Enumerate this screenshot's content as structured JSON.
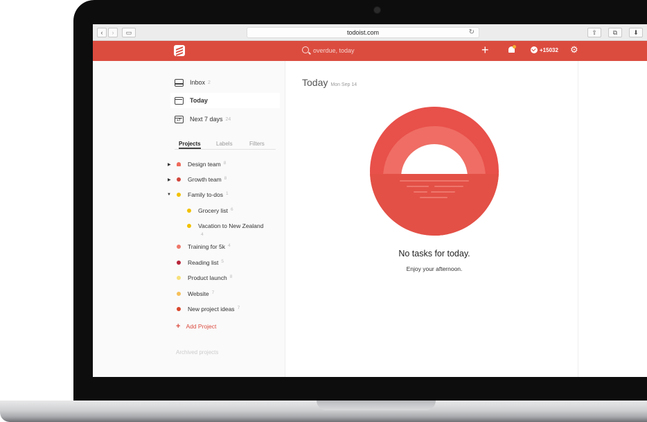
{
  "browser": {
    "url": "todoist.com"
  },
  "header": {
    "search_placeholder": "overdue, today",
    "karma": "+15032"
  },
  "sidebar": {
    "nav": [
      {
        "label": "Inbox",
        "count": "2"
      },
      {
        "label": "Today",
        "count": ""
      },
      {
        "label": "Next 7 days",
        "count": "24"
      }
    ],
    "tabs": [
      "Projects",
      "Labels",
      "Filters"
    ],
    "projects": [
      {
        "label": "Design team",
        "count": "8",
        "color": "#ee6a5b"
      },
      {
        "label": "Growth team",
        "count": "8",
        "color": "#d1453b"
      },
      {
        "label": "Family to-dos",
        "count": "1",
        "color": "#f2c100"
      },
      {
        "label": "Grocery list",
        "count": "6",
        "color": "#f2c100"
      },
      {
        "label": "Vacation to New Zealand",
        "count": "4",
        "color": "#f2c100"
      },
      {
        "label": "Training for 5k",
        "count": "4",
        "color": "#ee7769"
      },
      {
        "label": "Reading list",
        "count": "5",
        "color": "#b7253a"
      },
      {
        "label": "Product launch",
        "count": "8",
        "color": "#f7e07a"
      },
      {
        "label": "Website",
        "count": "7",
        "color": "#f6c05a"
      },
      {
        "label": "New project ideas",
        "count": "7",
        "color": "#d9472d"
      }
    ],
    "add_project": "Add Project",
    "archived": "Archived projects"
  },
  "main": {
    "title": "Today",
    "date": "Mon Sep 14",
    "empty_title": "No tasks for today.",
    "empty_subtitle": "Enjoy your afternoon."
  },
  "colors": {
    "accent": "#db4c3f"
  }
}
